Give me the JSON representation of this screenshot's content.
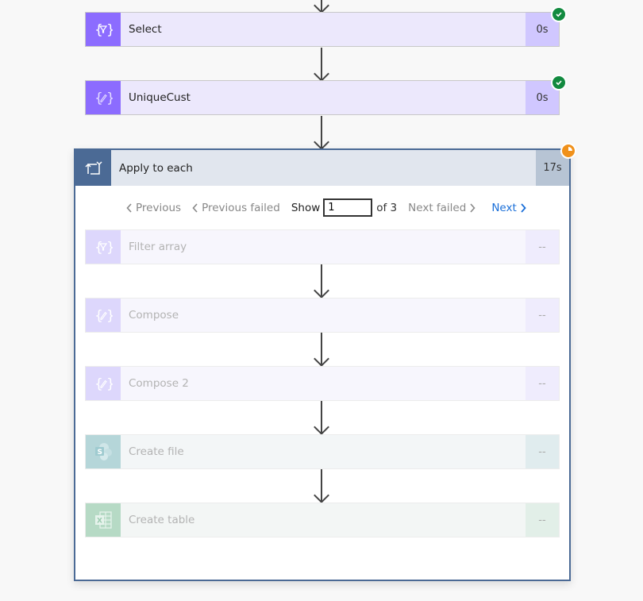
{
  "flow": {
    "top_steps": [
      {
        "title": "Select",
        "duration": "0s",
        "status": "succeeded",
        "icon": "data-operation-select-icon"
      },
      {
        "title": "UniqueCust",
        "duration": "0s",
        "status": "succeeded",
        "icon": "compose-icon"
      }
    ],
    "loop": {
      "title": "Apply to each",
      "duration": "17s",
      "status": "running",
      "icon": "loop-icon",
      "pager": {
        "previous": "Previous",
        "previous_failed": "Previous failed",
        "show": "Show",
        "current": "1",
        "of": "of 3",
        "next_failed": "Next failed",
        "next": "Next"
      },
      "steps": [
        {
          "title": "Filter array",
          "duration": "--",
          "icon": "filter-array-icon"
        },
        {
          "title": "Compose",
          "duration": "--",
          "icon": "compose-icon"
        },
        {
          "title": "Compose 2",
          "duration": "--",
          "icon": "compose-icon"
        },
        {
          "title": "Create file",
          "duration": "--",
          "icon": "sharepoint-icon"
        },
        {
          "title": "Create table",
          "duration": "--",
          "icon": "excel-icon"
        }
      ]
    }
  },
  "colors": {
    "data_ops": "#8c6cff",
    "loop": "#4b6a95",
    "success": "#128a3f",
    "running": "#f0911b",
    "link": "#1a6fd8"
  }
}
